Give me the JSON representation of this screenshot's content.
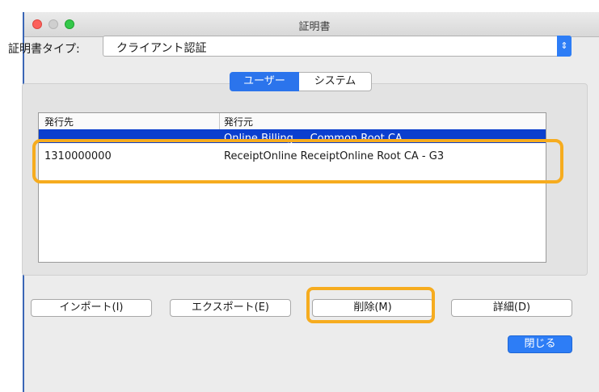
{
  "window": {
    "title": "証明書"
  },
  "certificate_type": {
    "label": "証明書タイプ:",
    "selected": "クライアント認証"
  },
  "segment": {
    "tabs": [
      "ユーザー",
      "システム"
    ],
    "active": "ユーザー"
  },
  "table": {
    "columns": [
      "発行先",
      "発行元"
    ],
    "rows": [
      {
        "issued_to": "",
        "issuer": "Online Billing ... Common Root CA",
        "selected": true
      },
      {
        "issued_to": "1310000000",
        "issuer": "ReceiptOnline ReceiptOnline Root CA - G3"
      }
    ]
  },
  "buttons": {
    "import": "インポート(I)",
    "export": "エクスポート(E)",
    "delete": "削除(M)",
    "detail": "詳細(D)",
    "close": "閉じる"
  },
  "colors": {
    "highlight": "#f6ac1f",
    "accent": "#2d7df6",
    "selection": "#0b3fcf"
  }
}
